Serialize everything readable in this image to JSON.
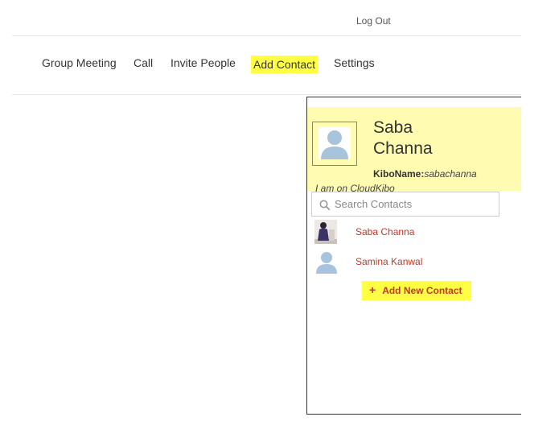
{
  "header": {
    "logout_label": "Log Out"
  },
  "nav": {
    "items": [
      {
        "label": "Group Meeting"
      },
      {
        "label": "Call"
      },
      {
        "label": "Invite People"
      },
      {
        "label": "Add Contact",
        "highlighted": true
      },
      {
        "label": "Settings"
      }
    ]
  },
  "profile": {
    "first_name": "Saba",
    "last_name": "Channa",
    "kiboname_label": "KiboName:",
    "kiboname_value": "sabachanna",
    "status": "I am on CloudKibo"
  },
  "search": {
    "placeholder": "Search Contacts"
  },
  "contacts": [
    {
      "name": "Saba Channa",
      "avatar": "photo"
    },
    {
      "name": "Samina Kanwal",
      "avatar": "default-user-icon"
    }
  ],
  "add_new_contact": {
    "icon": "plus-icon",
    "label": "Add New Contact"
  },
  "colors": {
    "highlight": "#ffff44",
    "profile_bg": "#fffbb0",
    "contact_name": "#c0392b",
    "avatar_icon": "#a8c4dc"
  }
}
